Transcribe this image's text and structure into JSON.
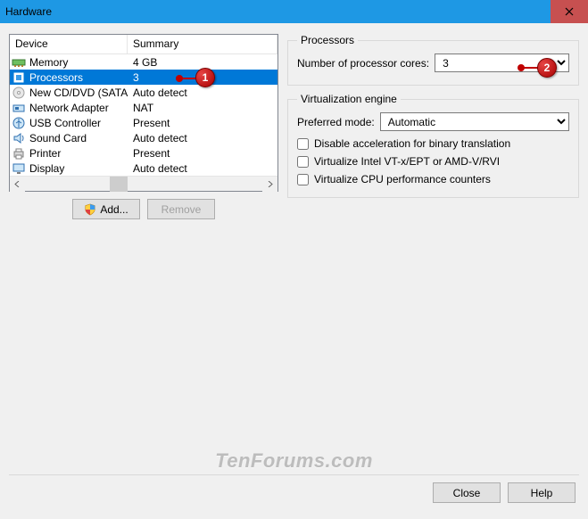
{
  "window": {
    "title": "Hardware"
  },
  "deviceList": {
    "columns": {
      "device": "Device",
      "summary": "Summary"
    },
    "rows": [
      {
        "icon": "memory-icon",
        "name": "Memory",
        "summary": "4 GB",
        "selected": false
      },
      {
        "icon": "cpu-icon",
        "name": "Processors",
        "summary": "3",
        "selected": true
      },
      {
        "icon": "disc-icon",
        "name": "New CD/DVD (SATA)",
        "summary": "Auto detect",
        "selected": false
      },
      {
        "icon": "nic-icon",
        "name": "Network Adapter",
        "summary": "NAT",
        "selected": false
      },
      {
        "icon": "usb-icon",
        "name": "USB Controller",
        "summary": "Present",
        "selected": false
      },
      {
        "icon": "sound-icon",
        "name": "Sound Card",
        "summary": "Auto detect",
        "selected": false
      },
      {
        "icon": "printer-icon",
        "name": "Printer",
        "summary": "Present",
        "selected": false
      },
      {
        "icon": "display-icon",
        "name": "Display",
        "summary": "Auto detect",
        "selected": false
      }
    ]
  },
  "buttons": {
    "add": "Add...",
    "remove": "Remove",
    "close": "Close",
    "help": "Help"
  },
  "processors": {
    "legend": "Processors",
    "coresLabel": "Number of processor cores:",
    "coresValue": "3"
  },
  "virtualization": {
    "legend": "Virtualization engine",
    "preferredLabel": "Preferred mode:",
    "preferredValue": "Automatic",
    "opt1": "Disable acceleration for binary translation",
    "opt2": "Virtualize Intel VT-x/EPT or AMD-V/RVI",
    "opt3": "Virtualize CPU performance counters"
  },
  "annotations": {
    "badge1": "1",
    "badge2": "2"
  },
  "watermark": "TenForums.com"
}
